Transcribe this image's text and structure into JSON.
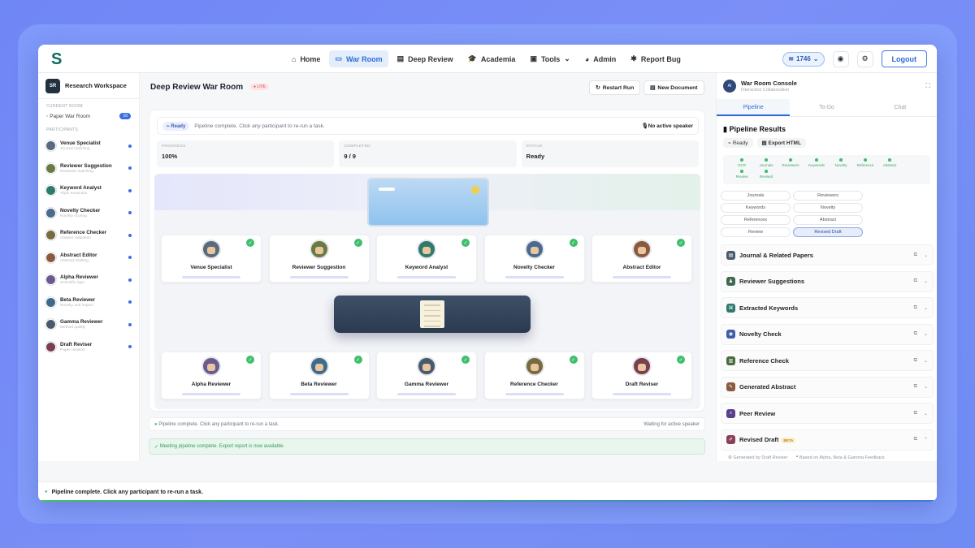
{
  "nav": {
    "logo": "S",
    "items": [
      {
        "label": "Home",
        "icon": "home-icon",
        "glyph": "⌂",
        "active": false
      },
      {
        "label": "War Room",
        "icon": "monitor-icon",
        "glyph": "▭",
        "active": true
      },
      {
        "label": "Deep Review",
        "icon": "document-icon",
        "glyph": "▤",
        "active": false
      },
      {
        "label": "Academia",
        "icon": "graduation-cap-icon",
        "glyph": "🎓",
        "active": false
      },
      {
        "label": "Tools",
        "icon": "toolbox-icon",
        "glyph": "▣",
        "active": false
      },
      {
        "label": "Admin",
        "icon": "pie-chart-icon",
        "glyph": "◕",
        "active": false
      },
      {
        "label": "Report Bug",
        "icon": "bug-icon",
        "glyph": "✱",
        "active": false
      }
    ],
    "tools_caret": "⌄",
    "credits": "1746",
    "logout": "Logout"
  },
  "sidebar": {
    "workspace_badge": "SR",
    "workspace_title": "Research Workspace",
    "current_room_label": "CURRENT ROOM",
    "room_name": "Paper War Room",
    "room_count": "10",
    "participants_label": "PARTICIPANTS",
    "participants": [
      {
        "name": "Venue Specialist",
        "sub": "Journal matching",
        "color": "#5a6a7d"
      },
      {
        "name": "Reviewer Suggestion",
        "sub": "Reviewer matching",
        "color": "#6b7a3f"
      },
      {
        "name": "Keyword Analyst",
        "sub": "Topic extraction",
        "color": "#2f7a6b"
      },
      {
        "name": "Novelty Checker",
        "sub": "Novelty scoring",
        "color": "#4a6b8d"
      },
      {
        "name": "Reference Checker",
        "sub": "Citation validation",
        "color": "#7a6a3f"
      },
      {
        "name": "Abstract Editor",
        "sub": "Abstract drafting",
        "color": "#8a5a3f"
      },
      {
        "name": "Alpha Reviewer",
        "sub": "Scientific rigor",
        "color": "#6a5a8d"
      },
      {
        "name": "Beta Reviewer",
        "sub": "Novelty and impact",
        "color": "#3f6a8a"
      },
      {
        "name": "Gamma Reviewer",
        "sub": "Method quality",
        "color": "#4a5a6d"
      },
      {
        "name": "Draft Reviser",
        "sub": "Paper revision",
        "color": "#7a3f4f"
      }
    ]
  },
  "main": {
    "title": "Deep Review War Room",
    "live": "● LIVE",
    "restart": "Restart Run",
    "new_doc": "New Document",
    "ready": "Ready",
    "status_text": "Pipeline complete. Click any participant to re-run a task.",
    "speaker": "No active speaker",
    "metrics": [
      {
        "label": "PROGRESS",
        "value": "100%"
      },
      {
        "label": "COMPLETED",
        "value": "9 / 9"
      },
      {
        "label": "STATUS",
        "value": "Ready"
      }
    ],
    "top_cards": [
      {
        "name": "Venue Specialist",
        "color": "#5a6a7d"
      },
      {
        "name": "Reviewer Suggestion",
        "color": "#6b7a3f"
      },
      {
        "name": "Keyword Analyst",
        "color": "#2f7a6b"
      },
      {
        "name": "Novelty Checker",
        "color": "#4a6b8d"
      },
      {
        "name": "Abstract Editor",
        "color": "#8a5a3f"
      }
    ],
    "bottom_cards": [
      {
        "name": "Alpha Reviewer",
        "color": "#6a5a8d"
      },
      {
        "name": "Beta Reviewer",
        "color": "#3f6a8a"
      },
      {
        "name": "Gamma Reviewer",
        "color": "#4a5a6d"
      },
      {
        "name": "Reference Checker",
        "color": "#7a6a3f"
      },
      {
        "name": "Draft Reviser",
        "color": "#7a3f4f"
      }
    ],
    "footer_status": "Pipeline complete. Click any participant to re-run a task.",
    "footer_waiting": "Waiting for active speaker",
    "footer_success": "Meeting pipeline complete. Export report is now available."
  },
  "bottom_status": "Pipeline complete. Click any participant to re-run a task.",
  "rpanel": {
    "badge": "AI",
    "title": "War Room Console",
    "subtitle": "Interactive Collaboration",
    "tabs": [
      "Pipeline",
      "To-Do",
      "Chat"
    ],
    "results_title": "Pipeline Results",
    "ready_btn": "Ready",
    "export_btn": "Export HTML",
    "steps": [
      "OCR",
      "Journals",
      "Reviewers",
      "Keywords",
      "Novelty",
      "Reference",
      "Abstract",
      "Review",
      "Revised"
    ],
    "chips": [
      "Journals",
      "Reviewers",
      "Keywords",
      "Novelty",
      "References",
      "Abstract",
      "Review",
      "Revised Draft"
    ],
    "selected_chip": "Revised Draft",
    "sections": [
      {
        "title": "Journal & Related Papers",
        "color": "#4a5a6d",
        "glyph": "▤"
      },
      {
        "title": "Reviewer Suggestions",
        "color": "#3f6a4f",
        "glyph": "♟"
      },
      {
        "title": "Extracted Keywords",
        "color": "#2f7a6b",
        "glyph": "⌘"
      },
      {
        "title": "Novelty Check",
        "color": "#3d5ea8",
        "glyph": "◉"
      },
      {
        "title": "Reference Check",
        "color": "#4a6a3f",
        "glyph": "▥"
      },
      {
        "title": "Generated Abstract",
        "color": "#8a5a3f",
        "glyph": "✎"
      },
      {
        "title": "Peer Review",
        "color": "#5a3f8a",
        "glyph": "⌕"
      },
      {
        "title": "Revised Draft",
        "color": "#8a3f5a",
        "glyph": "✐"
      }
    ],
    "beta": "BETA",
    "revised_meta_1": "Generated by Draft Reviser",
    "revised_meta_2": "Based on Alpha, Beta & Gamma Feedback"
  }
}
